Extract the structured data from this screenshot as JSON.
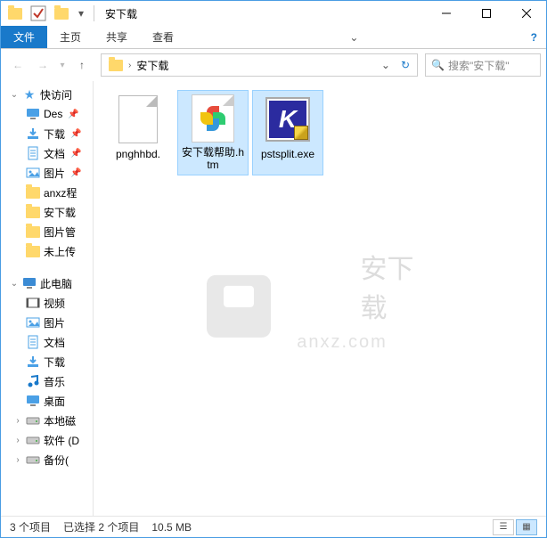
{
  "window": {
    "title": "安下载"
  },
  "ribbon": {
    "file": "文件",
    "home": "主页",
    "share": "共享",
    "view": "查看"
  },
  "address": {
    "crumb": "安下载",
    "search_placeholder": "搜索\"安下载\""
  },
  "nav": {
    "quick": "快访问",
    "items": [
      {
        "label": "Des",
        "icon": "desktop",
        "pin": true
      },
      {
        "label": "下载",
        "icon": "download",
        "pin": true
      },
      {
        "label": "文档",
        "icon": "doc",
        "pin": true
      },
      {
        "label": "图片",
        "icon": "pic",
        "pin": true
      },
      {
        "label": "anxz程",
        "icon": "folder",
        "pin": false
      },
      {
        "label": "安下载",
        "icon": "folder",
        "pin": false
      },
      {
        "label": "图片管",
        "icon": "folder",
        "pin": false
      },
      {
        "label": "未上传",
        "icon": "folder",
        "pin": false
      }
    ],
    "thispc": "此电脑",
    "pcitems": [
      {
        "label": "视频",
        "icon": "video"
      },
      {
        "label": "图片",
        "icon": "pic"
      },
      {
        "label": "文档",
        "icon": "doc"
      },
      {
        "label": "下载",
        "icon": "download"
      },
      {
        "label": "音乐",
        "icon": "music"
      },
      {
        "label": "桌面",
        "icon": "desktop"
      },
      {
        "label": "本地磁",
        "icon": "drive"
      },
      {
        "label": "软件 (D",
        "icon": "drive"
      },
      {
        "label": "备份(",
        "icon": "drive"
      }
    ]
  },
  "files": [
    {
      "name": "pnghhbd.",
      "type": "blank",
      "selected": false
    },
    {
      "name": "安下载帮助.htm",
      "type": "html",
      "selected": true
    },
    {
      "name": "pstsplit.exe",
      "type": "exe",
      "selected": true
    }
  ],
  "status": {
    "count": "3 个项目",
    "selected": "已选择 2 个项目",
    "size": "10.5 MB"
  },
  "watermark": {
    "line1": "安下载",
    "line2": "anxz.com"
  }
}
